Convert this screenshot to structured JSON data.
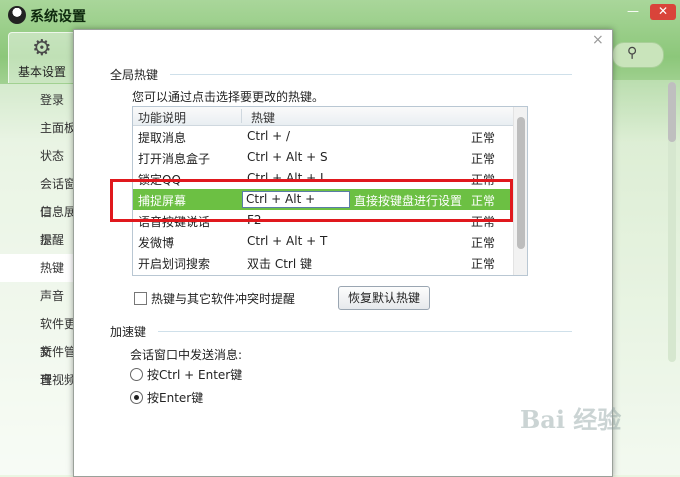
{
  "window": {
    "title": "系统设置",
    "min_glyph": "—",
    "close_glyph": "✕"
  },
  "top_tab": {
    "label": "基本设置",
    "icon": "gear-icon"
  },
  "nav": [
    {
      "label": "登录"
    },
    {
      "label": "主面板"
    },
    {
      "label": "状态"
    },
    {
      "label": "会话窗口"
    },
    {
      "label": "信息展示"
    },
    {
      "label": "提醒"
    },
    {
      "label": "热键",
      "active": true
    },
    {
      "label": "声音"
    },
    {
      "label": "软件更新"
    },
    {
      "label": "文件管理"
    },
    {
      "label": "音视频"
    }
  ],
  "dialog": {
    "close_glyph": "×",
    "section1": "全局热键",
    "description": "您可以通过点击选择要更改的热键。",
    "columns": [
      "功能说明",
      "热键"
    ],
    "rows": [
      {
        "func": "提取消息",
        "key": "Ctrl + /",
        "status": "正常"
      },
      {
        "func": "打开消息盒子",
        "key": "Ctrl + Alt + S",
        "status": "正常"
      },
      {
        "func": "锁定QQ",
        "key": "Ctrl + Alt + L",
        "status": "正常"
      },
      {
        "func": "捕捉屏幕",
        "key": "Ctrl + Alt +",
        "hint": "直接按键盘进行设置",
        "status": "正常",
        "selected": true
      },
      {
        "func": "语音按键说话",
        "key": "F2",
        "status": "正常"
      },
      {
        "func": "发微博",
        "key": "Ctrl + Alt + T",
        "status": "正常"
      },
      {
        "func": "开启划词搜索",
        "key": "双击 Ctrl 键",
        "status": "正常"
      }
    ],
    "conflict_checkbox": "热键与其它软件冲突时提醒",
    "restore_button": "恢复默认热键",
    "section2": "加速键",
    "send_label": "会话窗口中发送消息:",
    "radio_ctrl_enter": "按Ctrl + Enter键",
    "radio_enter": "按Enter键"
  },
  "watermark": "Bai 经验"
}
